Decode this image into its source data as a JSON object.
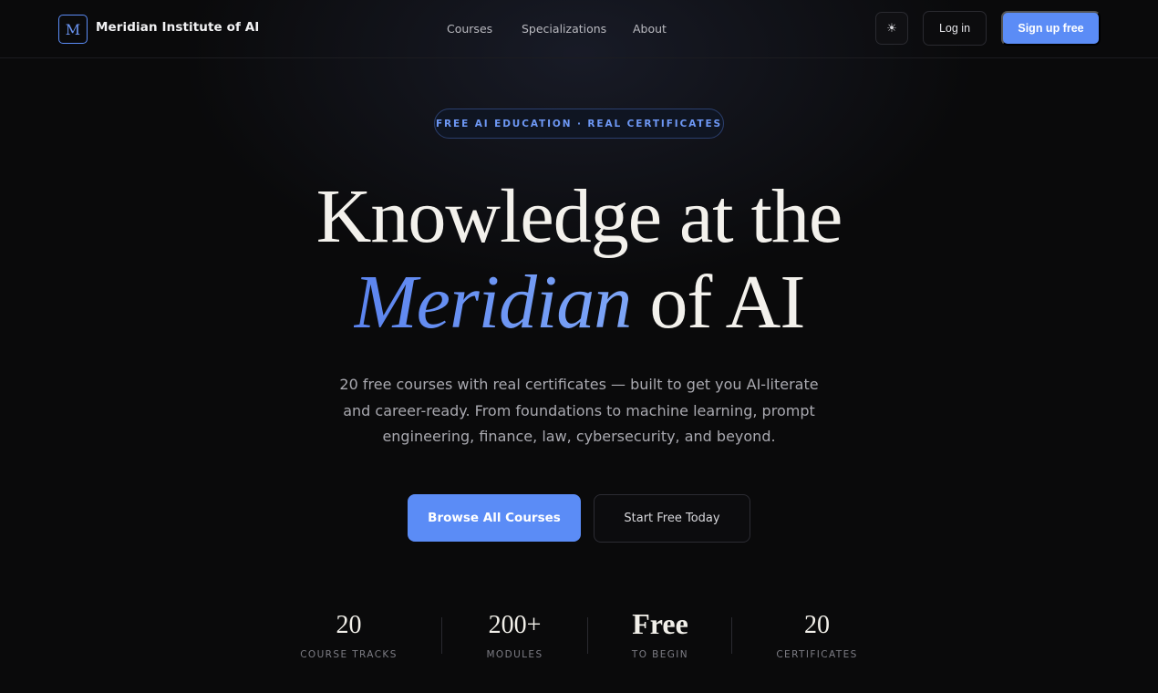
{
  "nav": {
    "logo_letter": "M",
    "brand": "Meridian Institute of AI",
    "links": [
      "Courses",
      "Specializations",
      "About"
    ],
    "theme_icon": "☀",
    "login": "Log in",
    "signup": "Sign up free"
  },
  "hero": {
    "badge": "FREE AI EDUCATION · REAL CERTIFICATES",
    "headline_line1": "Knowledge at the",
    "headline_accent": "Meridian",
    "headline_line2_rest": " of AI",
    "subtitle": "20 free courses with real certificates — built to get you AI-literate and career-ready. From foundations to machine learning, prompt engineering, finance, law, cybersecurity, and beyond.",
    "cta_primary": "Browse All Courses",
    "cta_secondary": "Start Free Today"
  },
  "stats": [
    {
      "value": "20",
      "label": "COURSE TRACKS"
    },
    {
      "value": "200+",
      "label": "MODULES"
    },
    {
      "value": "Free",
      "label": "TO BEGIN"
    },
    {
      "value": "20",
      "label": "CERTIFICATES"
    }
  ],
  "colors": {
    "background": "#0a0a0b",
    "accent": "#5b8cf6"
  }
}
